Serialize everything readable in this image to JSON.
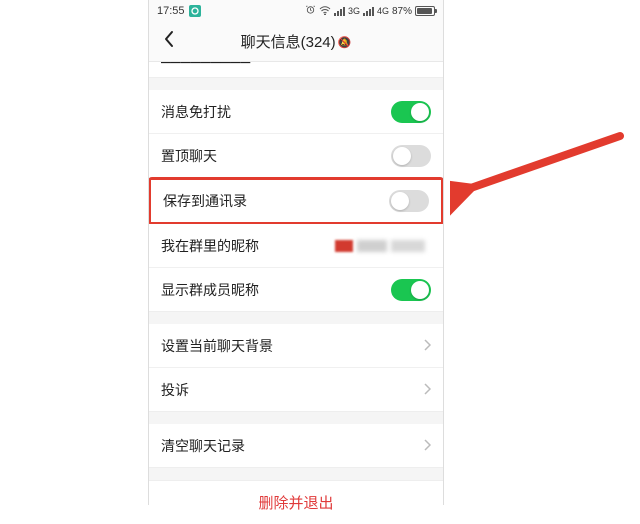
{
  "status": {
    "time": "17:55",
    "network1": "3G",
    "network2": "4G",
    "battery_pct": "87%"
  },
  "nav": {
    "title": "聊天信息(324)"
  },
  "partial_row_text": "———————",
  "rows": {
    "mute": {
      "label": "消息免打扰",
      "on": true
    },
    "sticky": {
      "label": "置顶聊天",
      "on": false
    },
    "save_contacts": {
      "label": "保存到通讯录",
      "on": false
    },
    "my_alias": {
      "label": "我在群里的昵称"
    },
    "show_member_alias": {
      "label": "显示群成员昵称",
      "on": true
    },
    "set_bg": {
      "label": "设置当前聊天背景"
    },
    "report": {
      "label": "投诉"
    },
    "clear_history": {
      "label": "清空聊天记录"
    },
    "delete_exit": {
      "label": "删除并退出"
    }
  }
}
